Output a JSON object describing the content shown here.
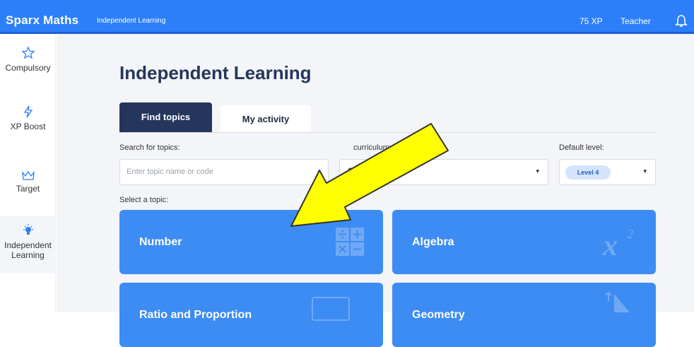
{
  "header": {
    "brand": "Sparx Maths",
    "subtitle": "Independent Learning",
    "xp": "75 XP",
    "user": "Teacher",
    "bell_icon": "bell-icon",
    "color": "#2d7ff9"
  },
  "sidebar": {
    "items": [
      {
        "label": "Compulsory",
        "icon": "star-icon"
      },
      {
        "label": "XP Boost",
        "icon": "lightning-icon"
      },
      {
        "label": "Target",
        "icon": "crown-icon"
      },
      {
        "label_line1": "Independent",
        "label_line2": "Learning",
        "icon": "bulb-icon",
        "active": true
      }
    ]
  },
  "page": {
    "title": "Independent Learning",
    "tabs": [
      {
        "label": "Find topics",
        "selected": true
      },
      {
        "label": "My activity",
        "selected": false
      }
    ],
    "search": {
      "label": "Search for topics:",
      "placeholder": "Enter topic name or code",
      "value": ""
    },
    "curriculum": {
      "label": "curriculum:",
      "value": "GCSE"
    },
    "level": {
      "label": "Default level:",
      "value": "Level 4"
    },
    "select_label": "Select a topic:",
    "topics": [
      {
        "name": "Number",
        "icon": "operators-icon"
      },
      {
        "name": "Algebra",
        "icon": "x-squared-icon"
      },
      {
        "name": "Ratio and Proportion",
        "icon": "ratio-icon"
      },
      {
        "name": "Geometry",
        "icon": "geometry-icon"
      }
    ],
    "accent": "#3d8cf3",
    "annotation_arrow_color": "#ffff00"
  }
}
